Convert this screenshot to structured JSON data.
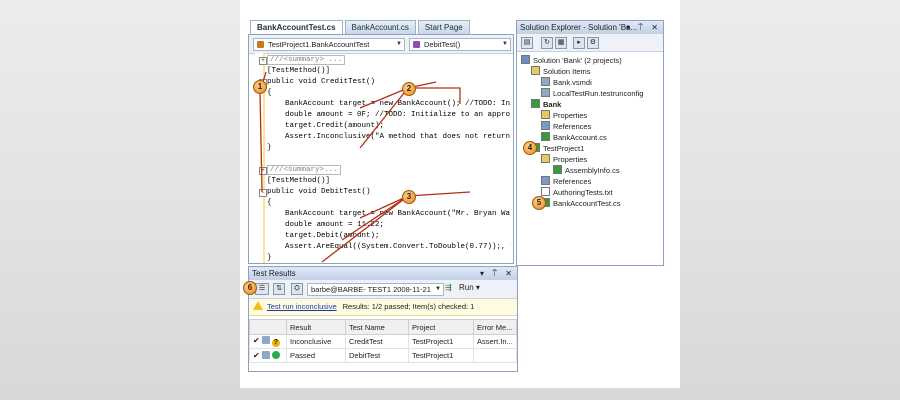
{
  "editor": {
    "tabs": [
      {
        "label": "BankAccountTest.cs",
        "active": true
      },
      {
        "label": "BankAccount.cs",
        "active": false
      },
      {
        "label": "Start Page",
        "active": false
      }
    ],
    "type_dropdown": "TestProject1.BankAccountTest",
    "member_dropdown": "DebitTest()",
    "code_lines": [
      "///<summary> ...",
      "[TestMethod()]",
      "public void CreditTest()",
      "{",
      "    BankAccount target = new BankAccount(); //TODO: Ini...",
      "    double amount = 0F; //TODO: Initialize to an appro...",
      "    target.Credit(amount);",
      "    Assert.Inconclusive(\"A method that does not return...",
      "}",
      "",
      "///<summary>...",
      "[TestMethod()]",
      "public void DebitTest()",
      "{",
      "    BankAccount target = new BankAccount(\"Mr. Bryan Wal...",
      "    double amount = 11.22;",
      "    target.Debit(amount);",
      "    Assert.AreEqual((System.Convert.ToDouble(0.77));, targ...",
      "}"
    ]
  },
  "solution_explorer": {
    "title": "Solution Explorer - Solution 'Ba...",
    "title_controls": "▾ ⍑ ✕",
    "toolbar_icons": [
      "properties-icon",
      "refresh-icon",
      "show-all-files-icon",
      "view-code-icon",
      "view-designer-icon"
    ],
    "tree": [
      {
        "label": "Solution 'Bank' (2 projects)",
        "indent": 0,
        "icon": "solution-icon",
        "color": "#6a8cc7"
      },
      {
        "label": "Solution Items",
        "indent": 1,
        "icon": "folder-icon",
        "color": "#e8c860"
      },
      {
        "label": "Bank.vsmdi",
        "indent": 2,
        "icon": "file-icon",
        "color": "#8fa8c8"
      },
      {
        "label": "LocalTestRun.testrunconfig",
        "indent": 2,
        "icon": "file-icon",
        "color": "#8fa8c8"
      },
      {
        "label": "Bank",
        "indent": 1,
        "icon": "project-icon",
        "color": "#3a9a3a",
        "bold": true
      },
      {
        "label": "Properties",
        "indent": 2,
        "icon": "folder-icon",
        "color": "#e8c860"
      },
      {
        "label": "References",
        "indent": 2,
        "icon": "references-icon",
        "color": "#7a9ac8"
      },
      {
        "label": "BankAccount.cs",
        "indent": 2,
        "icon": "cs-file-icon",
        "color": "#3a9a3a"
      },
      {
        "label": "TestProject1",
        "indent": 1,
        "icon": "test-project-icon",
        "color": "#3a9a3a"
      },
      {
        "label": "Properties",
        "indent": 2,
        "icon": "folder-icon",
        "color": "#e8c860"
      },
      {
        "label": "AssemblyInfo.cs",
        "indent": 3,
        "icon": "cs-file-icon",
        "color": "#3a9a3a"
      },
      {
        "label": "References",
        "indent": 2,
        "icon": "references-icon",
        "color": "#7a9ac8"
      },
      {
        "label": "AuthoringTests.txt",
        "indent": 2,
        "icon": "text-file-icon",
        "color": "#ffffff"
      },
      {
        "label": "BankAccountTest.cs",
        "indent": 2,
        "icon": "cs-file-icon",
        "color": "#3a9a3a"
      }
    ]
  },
  "test_results": {
    "title": "Test Results",
    "title_controls": "▾ ⍑ ✕",
    "run_selector": "barbe@BARBE- TEST1 2008-11-21",
    "run_button": "Run ▾",
    "status_link": "Test run inconclusive",
    "status_text": "Results: 1/2 passed; Item(s) checked: 1",
    "columns": [
      "Result",
      "Test Name",
      "Project",
      "Error Me..."
    ],
    "rows": [
      {
        "result": "Inconclusive",
        "test_name": "CreditTest",
        "project": "TestProject1",
        "error": "Assert.In...",
        "status_color": "#f0b000",
        "status_symbol": "?"
      },
      {
        "result": "Passed",
        "test_name": "DebitTest",
        "project": "TestProject1",
        "error": "",
        "status_color": "#2fa84f",
        "status_symbol": ""
      }
    ]
  },
  "callouts": [
    "1",
    "2",
    "3",
    "4",
    "5",
    "6"
  ],
  "colors": {
    "callout": "#e8861a",
    "accent_blue": "#8da2c0",
    "warning": "#f2c01d"
  }
}
